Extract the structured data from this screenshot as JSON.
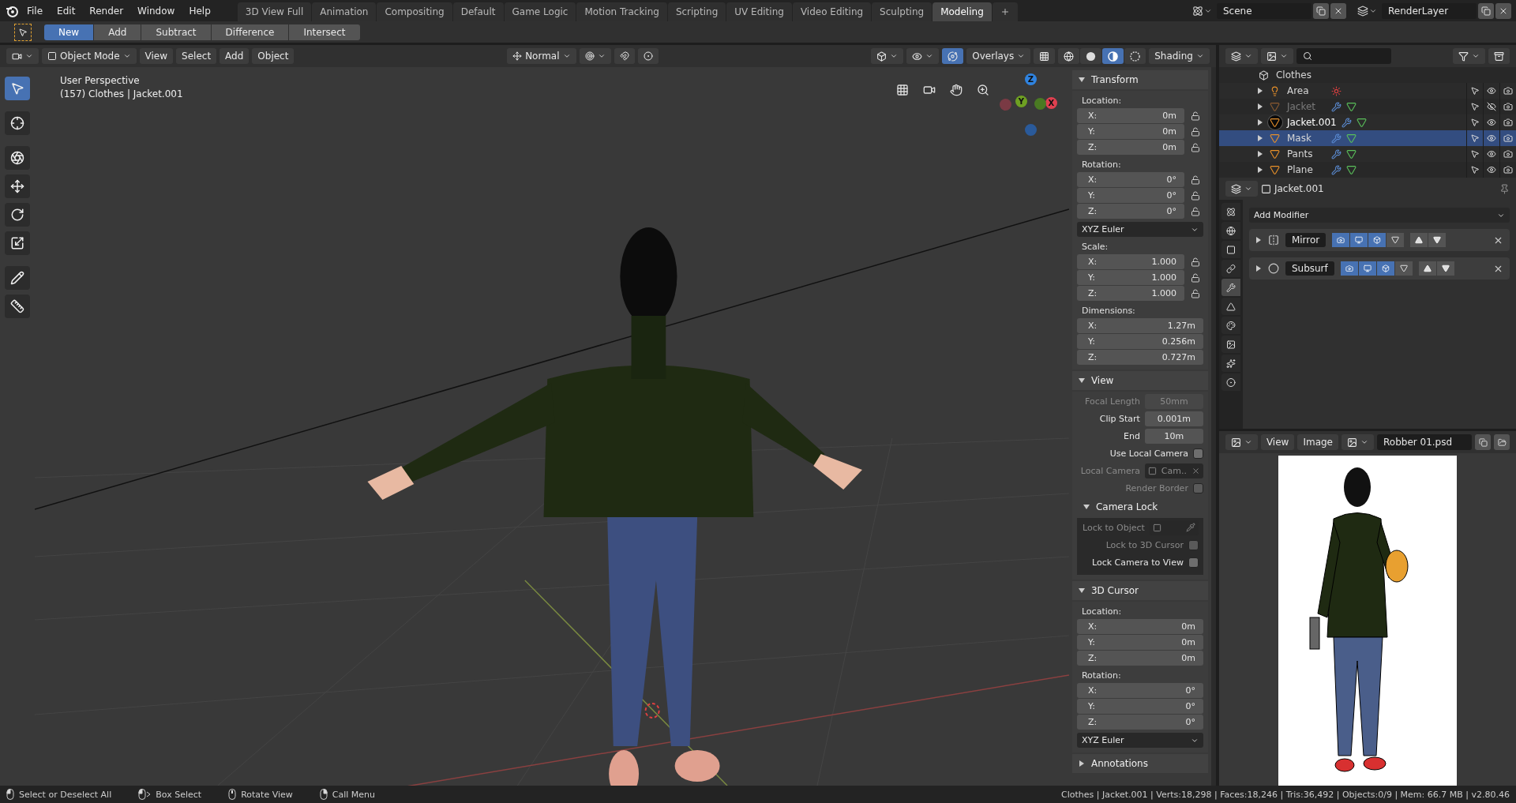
{
  "top_menu": [
    "File",
    "Edit",
    "Render",
    "Window",
    "Help"
  ],
  "workspaces": [
    {
      "label": "3D View Full",
      "selected": false
    },
    {
      "label": "Animation",
      "selected": false
    },
    {
      "label": "Compositing",
      "selected": false
    },
    {
      "label": "Default",
      "selected": false
    },
    {
      "label": "Game Logic",
      "selected": false
    },
    {
      "label": "Motion Tracking",
      "selected": false
    },
    {
      "label": "Scripting",
      "selected": false
    },
    {
      "label": "UV Editing",
      "selected": false
    },
    {
      "label": "Video Editing",
      "selected": false
    },
    {
      "label": "Sculpting",
      "selected": false
    },
    {
      "label": "Modeling",
      "selected": true
    }
  ],
  "scene": {
    "name": "Scene"
  },
  "view_layer": {
    "name": "RenderLayer"
  },
  "boolean_modes": [
    {
      "label": "New",
      "selected": true
    },
    {
      "label": "Add",
      "selected": false
    },
    {
      "label": "Subtract",
      "selected": false
    },
    {
      "label": "Difference",
      "selected": false
    },
    {
      "label": "Intersect",
      "selected": false
    }
  ],
  "viewport": {
    "mode": "Object Mode",
    "menus": [
      "View",
      "Select",
      "Add",
      "Object"
    ],
    "orientation": "Normal",
    "overlays": {
      "label": "Overlays",
      "on": true
    },
    "shading_label": "Shading",
    "shading_modes": [
      {
        "kind": "wireframe",
        "selected": false
      },
      {
        "kind": "solid",
        "selected": false
      },
      {
        "kind": "material",
        "selected": true
      },
      {
        "kind": "rendered",
        "selected": false
      }
    ],
    "view_name": "User Perspective",
    "object_info": "(157) Clothes | Jacket.001",
    "axes": [
      "Z",
      "Y",
      "X"
    ]
  },
  "tools": [
    {
      "kind": "select",
      "selected": true
    },
    {
      "kind": "cursor",
      "selected": false
    },
    {
      "kind": "transform",
      "selected": false
    },
    {
      "kind": "move",
      "selected": false
    },
    {
      "kind": "rotate",
      "selected": false
    },
    {
      "kind": "scale",
      "selected": false
    },
    {
      "kind": "annotate",
      "selected": false
    },
    {
      "kind": "measure",
      "selected": false
    }
  ],
  "sidebar": {
    "transform": {
      "title": "Transform",
      "expanded": true,
      "groups": [
        {
          "label": "Location:",
          "rows": [
            {
              "axis": "X:",
              "value": "0m",
              "locked": false
            },
            {
              "axis": "Y:",
              "value": "0m",
              "locked": false
            },
            {
              "axis": "Z:",
              "value": "0m",
              "locked": false
            }
          ]
        },
        {
          "label": "Rotation:",
          "rows": [
            {
              "axis": "X:",
              "value": "0°",
              "locked": false
            },
            {
              "axis": "Y:",
              "value": "0°",
              "locked": false
            },
            {
              "axis": "Z:",
              "value": "0°",
              "locked": false
            }
          ],
          "mode": "XYZ Euler"
        },
        {
          "label": "Scale:",
          "rows": [
            {
              "axis": "X:",
              "value": "1.000",
              "locked": false
            },
            {
              "axis": "Y:",
              "value": "1.000",
              "locked": false
            },
            {
              "axis": "Z:",
              "value": "1.000",
              "locked": false
            }
          ]
        },
        {
          "label": "Dimensions:",
          "rows": [
            {
              "axis": "X:",
              "value": "1.27m"
            },
            {
              "axis": "Y:",
              "value": "0.256m"
            },
            {
              "axis": "Z:",
              "value": "0.727m"
            }
          ]
        }
      ]
    },
    "view": {
      "title": "View",
      "expanded": true,
      "rows": [
        {
          "kind": "field",
          "label": "Focal Length",
          "value": "50mm",
          "disabled": true
        },
        {
          "kind": "field",
          "label": "Clip Start",
          "value": "0.001m",
          "disabled": false
        },
        {
          "kind": "field",
          "label": "End",
          "value": "10m",
          "disabled": false
        },
        {
          "kind": "check",
          "label": "Use Local Camera",
          "checked": false,
          "disabled": false
        },
        {
          "kind": "object",
          "label": "Local Camera",
          "value": "Cam..",
          "disabled": true
        },
        {
          "kind": "check",
          "label": "Render Border",
          "checked": false,
          "disabled": true
        }
      ],
      "camera_lock": {
        "title": "Camera Lock",
        "expanded": true,
        "rows": [
          {
            "kind": "object",
            "label": "Lock to Object",
            "disabled": true
          },
          {
            "kind": "check",
            "label": "Lock to 3D Cursor",
            "checked": false,
            "disabled": true
          },
          {
            "kind": "check",
            "label": "Lock Camera to View",
            "checked": false,
            "disabled": false
          }
        ]
      }
    },
    "cursor": {
      "title": "3D Cursor",
      "expanded": true,
      "groups": [
        {
          "label": "Location:",
          "rows": [
            {
              "axis": "X:",
              "value": "0m"
            },
            {
              "axis": "Y:",
              "value": "0m"
            },
            {
              "axis": "Z:",
              "value": "0m"
            }
          ]
        },
        {
          "label": "Rotation:",
          "rows": [
            {
              "axis": "X:",
              "value": "0°"
            },
            {
              "axis": "Y:",
              "value": "0°"
            },
            {
              "axis": "Z:",
              "value": "0°"
            }
          ],
          "mode": "XYZ Euler"
        }
      ]
    },
    "annotations": {
      "title": "Annotations",
      "expanded": false
    }
  },
  "outliner": {
    "rows": [
      {
        "name": "Clothes",
        "kind": "collection",
        "selected": false,
        "active": false,
        "hidden": false
      },
      {
        "name": "Area",
        "kind": "light",
        "selected": false,
        "active": false,
        "hidden": false
      },
      {
        "name": "Jacket",
        "kind": "mesh",
        "selected": false,
        "active": false,
        "hidden": true
      },
      {
        "name": "Jacket.001",
        "kind": "mesh",
        "selected": false,
        "active": true,
        "hidden": false
      },
      {
        "name": "Mask",
        "kind": "mesh",
        "selected": true,
        "active": false,
        "hidden": false
      },
      {
        "name": "Pants",
        "kind": "mesh",
        "selected": false,
        "active": false,
        "hidden": false
      },
      {
        "name": "Plane",
        "kind": "mesh",
        "selected": false,
        "active": false,
        "hidden": false
      }
    ]
  },
  "properties": {
    "object_name": "Jacket.001",
    "add_modifier": "Add Modifier",
    "tabs": [
      {
        "kind": "scene",
        "selected": false
      },
      {
        "kind": "world",
        "selected": false
      },
      {
        "kind": "object",
        "selected": false
      },
      {
        "kind": "constraints",
        "selected": false
      },
      {
        "kind": "modifiers",
        "selected": true
      },
      {
        "kind": "data",
        "selected": false
      },
      {
        "kind": "material",
        "selected": false
      },
      {
        "kind": "texture",
        "selected": false
      },
      {
        "kind": "particles",
        "selected": false
      },
      {
        "kind": "physics",
        "selected": false
      }
    ],
    "modifiers": [
      {
        "name": "Mirror",
        "kind": "mirror",
        "render": true,
        "realtime": true,
        "edit_mode": true,
        "cage": false
      },
      {
        "name": "Subsurf",
        "kind": "subsurf",
        "render": true,
        "realtime": true,
        "edit_mode": true,
        "cage": false
      }
    ]
  },
  "image_editor": {
    "menus": [
      "View",
      "Image"
    ],
    "image_name": "Robber 01.psd"
  },
  "status": {
    "hints": [
      {
        "kind": "left",
        "label": "Select or Deselect All"
      },
      {
        "kind": "drag",
        "label": "Box Select"
      },
      {
        "kind": "middle",
        "label": "Rotate View"
      },
      {
        "kind": "right",
        "label": "Call Menu"
      }
    ],
    "stats": "Clothes | Jacket.001 | Verts:18,298 | Faces:18,246 | Tris:36,492 | Objects:0/9 | Mem: 66.7 MB | v2.80.46"
  }
}
